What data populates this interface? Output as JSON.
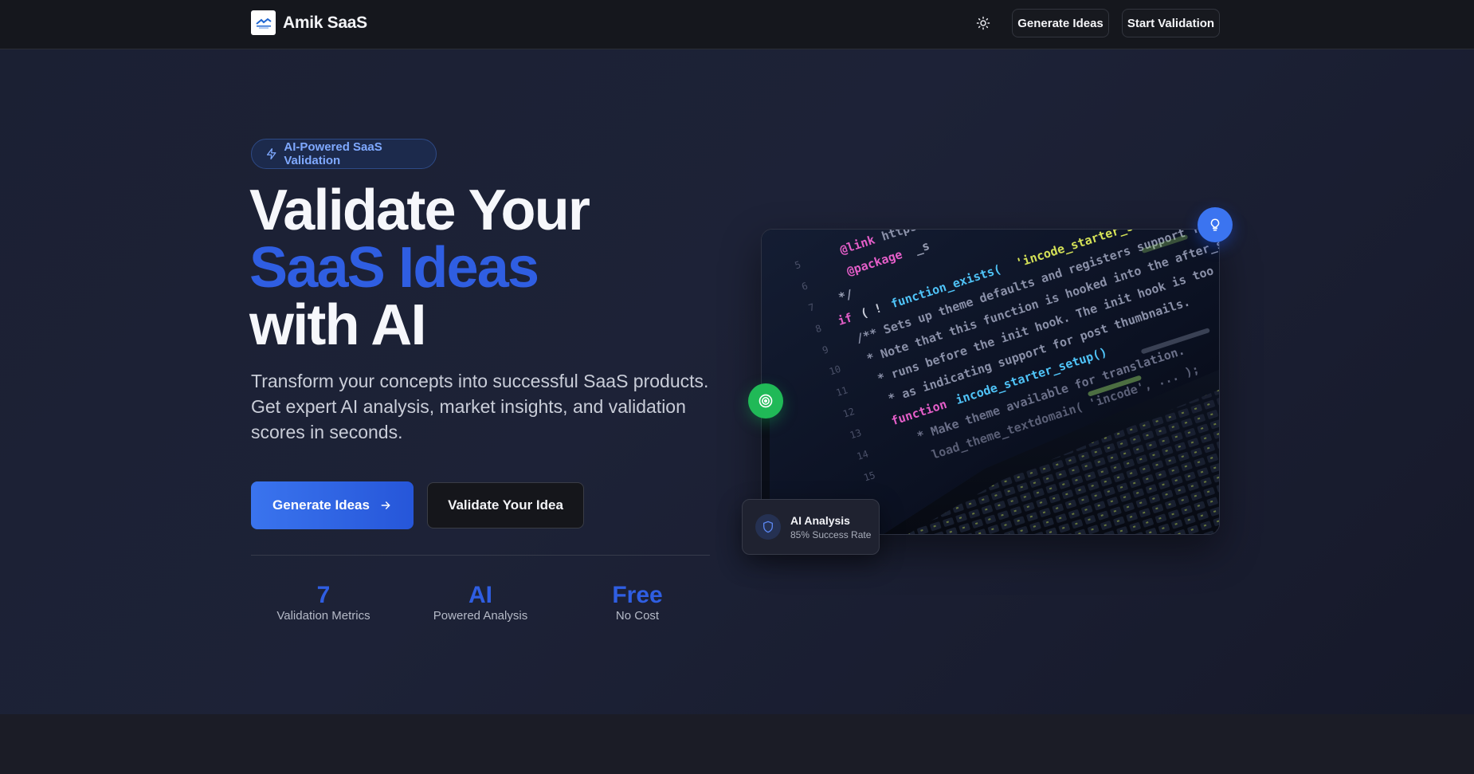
{
  "header": {
    "brand": "Amik SaaS",
    "theme_icon": "sun-icon",
    "nav": {
      "generate_label": "Generate Ideas",
      "start_label": "Start Validation"
    }
  },
  "hero": {
    "badge": "AI-Powered SaaS Validation",
    "badge_icon": "zap-icon",
    "headline": {
      "line1": "Validate Your",
      "line2": "SaaS Ideas",
      "line3": "with AI"
    },
    "subtext": "Transform your concepts into successful SaaS products. Get expert AI analysis, market insights, and validation scores in seconds.",
    "cta_primary": "Generate Ideas",
    "cta_secondary": "Validate Your Idea",
    "stats": [
      {
        "value": "7",
        "label": "Validation Metrics"
      },
      {
        "value": "AI",
        "label": "Powered Analysis"
      },
      {
        "value": "Free",
        "label": "No Cost"
      }
    ]
  },
  "visual": {
    "analysis_title": "AI Analysis",
    "analysis_sub": "85% Success Rate",
    "float_icons": [
      "lightbulb-icon",
      "target-icon",
      "shield-icon"
    ]
  },
  "colors": {
    "accent": "#2f5ee2",
    "primary_button": "#3a74ee",
    "green": "#20b957",
    "background": "#1b2033"
  }
}
